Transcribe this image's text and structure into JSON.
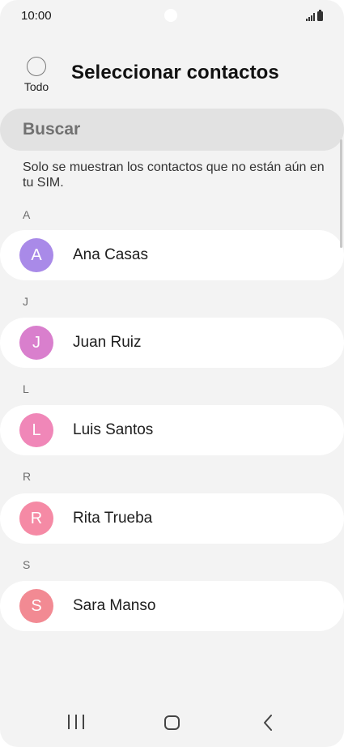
{
  "status_bar": {
    "time": "10:00"
  },
  "header": {
    "select_all_label": "Todo",
    "title": "Seleccionar contactos"
  },
  "search": {
    "placeholder": "Buscar"
  },
  "info_text": "Solo se muestran los contactos que no están aún en tu SIM.",
  "sections": [
    {
      "letter": "A",
      "contact": {
        "initial": "A",
        "name": "Ana Casas",
        "avatar_color": "#a98ae8"
      }
    },
    {
      "letter": "J",
      "contact": {
        "initial": "J",
        "name": "Juan Ruiz",
        "avatar_color": "#d97fcd"
      }
    },
    {
      "letter": "L",
      "contact": {
        "initial": "L",
        "name": "Luis Santos",
        "avatar_color": "#f087b8"
      }
    },
    {
      "letter": "R",
      "contact": {
        "initial": "R",
        "name": "Rita Trueba",
        "avatar_color": "#f58aa5"
      }
    },
    {
      "letter": "S",
      "contact": {
        "initial": "S",
        "name": "Sara Manso",
        "avatar_color": "#f28a93"
      }
    }
  ],
  "nav_bar": {
    "icons": [
      "recents-icon",
      "home-icon",
      "back-icon"
    ]
  }
}
